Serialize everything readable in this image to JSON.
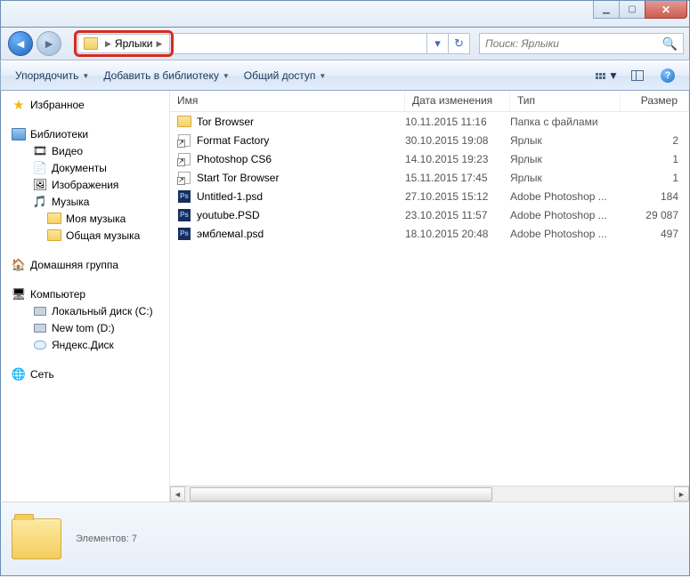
{
  "breadcrumb": {
    "label": "Ярлыки"
  },
  "search": {
    "placeholder": "Поиск: Ярлыки"
  },
  "toolbar": {
    "organize": "Упорядочить",
    "add_library": "Добавить в библиотеку",
    "share": "Общий доступ"
  },
  "sidebar": {
    "favorites": "Избранное",
    "libraries": "Библиотеки",
    "video": "Видео",
    "documents": "Документы",
    "pictures": "Изображения",
    "music": "Музыка",
    "my_music": "Моя музыка",
    "public_music": "Общая музыка",
    "homegroup": "Домашняя группа",
    "computer": "Компьютер",
    "drive_c": "Локальный диск (C:)",
    "drive_d": "New tom (D:)",
    "yadisk": "Яндекс.Диск",
    "network": "Сеть"
  },
  "columns": {
    "name": "Имя",
    "date": "Дата изменения",
    "type": "Тип",
    "size": "Размер"
  },
  "files": [
    {
      "icon": "folder",
      "name": "Tor Browser",
      "date": "10.11.2015 11:16",
      "type": "Папка с файлами",
      "size": ""
    },
    {
      "icon": "lnk",
      "name": "Format Factory",
      "date": "30.10.2015 19:08",
      "type": "Ярлык",
      "size": "2"
    },
    {
      "icon": "lnk",
      "name": "Photoshop CS6",
      "date": "14.10.2015 19:23",
      "type": "Ярлык",
      "size": "1"
    },
    {
      "icon": "lnk",
      "name": "Start Tor Browser",
      "date": "15.11.2015 17:45",
      "type": "Ярлык",
      "size": "1"
    },
    {
      "icon": "psd",
      "name": "Untitled-1.psd",
      "date": "27.10.2015 15:12",
      "type": "Adobe Photoshop ...",
      "size": "184"
    },
    {
      "icon": "psd",
      "name": "youtube.PSD",
      "date": "23.10.2015 11:57",
      "type": "Adobe Photoshop ...",
      "size": "29 087"
    },
    {
      "icon": "psd",
      "name": "эмблемаI.psd",
      "date": "18.10.2015 20:48",
      "type": "Adobe Photoshop ...",
      "size": "497"
    }
  ],
  "status": {
    "count_label": "Элементов: 7"
  }
}
